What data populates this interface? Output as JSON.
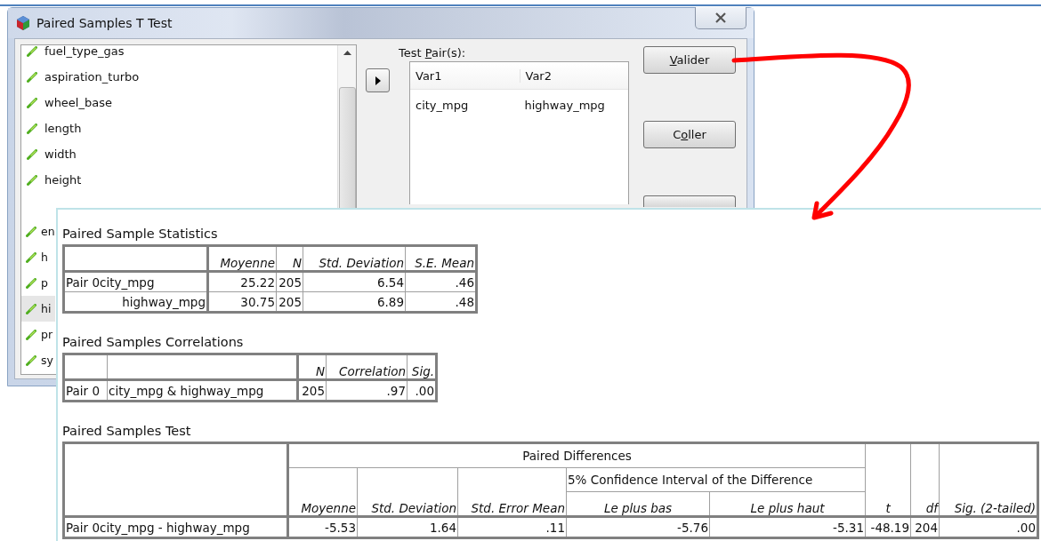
{
  "dialog": {
    "title": "Paired Samples T Test",
    "variables": [
      {
        "name": "fuel_type_gas",
        "selected": false
      },
      {
        "name": "aspiration_turbo",
        "selected": false
      },
      {
        "name": "wheel_base",
        "selected": false
      },
      {
        "name": "length",
        "selected": false
      },
      {
        "name": "width",
        "selected": false
      },
      {
        "name": "height",
        "selected": false
      }
    ],
    "variables_partly_covered": [
      {
        "name": "en",
        "selected": false
      },
      {
        "name": "h",
        "selected": false
      },
      {
        "name": "p",
        "selected": false
      },
      {
        "name": "hi",
        "selected": true
      },
      {
        "name": "pr",
        "selected": false
      },
      {
        "name": "sy",
        "selected": false
      }
    ],
    "test_pairs": {
      "label": {
        "before": "Test ",
        "key": "P",
        "after": "air(s):"
      },
      "columns": [
        "Var1",
        "Var2"
      ],
      "rows": [
        [
          "city_mpg",
          "highway_mpg"
        ]
      ]
    },
    "buttons": [
      {
        "key": "V",
        "after": "alider"
      },
      {
        "before": "C",
        "key": "o",
        "after": "ller"
      }
    ]
  },
  "output": {
    "statistics": {
      "title": "Paired Sample Statistics",
      "columns": [
        "Moyenne",
        "N",
        "Std. Deviation",
        "S.E. Mean"
      ],
      "rows": [
        {
          "pair": "Pair 0",
          "variable": "city_mpg",
          "values": [
            "25.22",
            "205",
            "6.54",
            ".46"
          ]
        },
        {
          "variable": "highway_mpg",
          "values": [
            "30.75",
            "205",
            "6.89",
            ".48"
          ]
        }
      ]
    },
    "correlations": {
      "title": "Paired Samples Correlations",
      "columns": [
        "N",
        "Correlation",
        "Sig."
      ],
      "rows": [
        {
          "pair": "Pair 0",
          "variable": "city_mpg & highway_mpg",
          "values": [
            "205",
            ".97",
            ".00"
          ]
        }
      ]
    },
    "test": {
      "title": "Paired Samples Test",
      "group_header": "Paired Differences",
      "ci_header": "5% Confidence Interval of the Difference",
      "columns": [
        "Moyenne",
        "Std. Deviation",
        "Std. Error Mean",
        "Le plus bas",
        "Le plus haut",
        "t",
        "df",
        "Sig. (2-tailed)"
      ],
      "rows": [
        {
          "pair": "Pair 0",
          "variable": "city_mpg - highway_mpg",
          "values": [
            "-5.53",
            "1.64",
            ".11",
            "-5.76",
            "-5.31",
            "-48.19",
            "204",
            ".00"
          ]
        }
      ]
    }
  }
}
